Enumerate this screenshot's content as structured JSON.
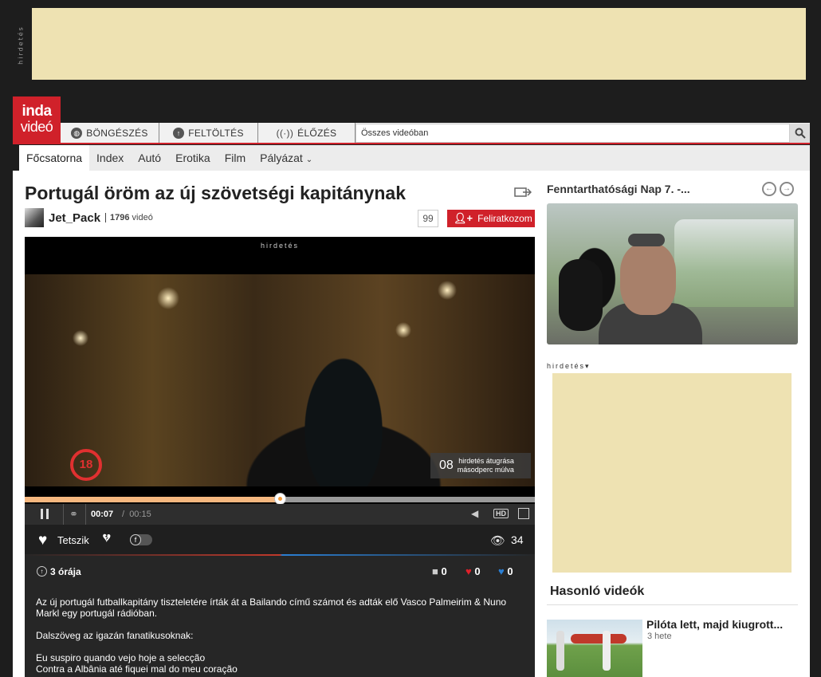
{
  "top_ad": {
    "label": "hirdetés"
  },
  "logo": {
    "line1": "inda",
    "line2": "videó"
  },
  "nav": {
    "browse": "BÖNGÉSZÉS",
    "upload": "FELTÖLTÉS",
    "live": "ÉLŐZÉS",
    "search_placeholder": "Összes videóban"
  },
  "subnav": {
    "items": [
      "Főcsatorna",
      "Index",
      "Autó",
      "Erotika",
      "Film",
      "Pályázat"
    ],
    "active_index": 0
  },
  "video": {
    "title": "Portugál öröm az új szövetségi kapitánynak",
    "uploader": "Jet_Pack",
    "uploader_video_count": "1796",
    "uploader_video_unit": "videó",
    "subscriber_count": "99",
    "subscribe_label": "Feliratkozom",
    "player_ad_label": "hirdetés",
    "age_rating": "18",
    "skip_seconds": "08",
    "skip_text_1": "hirdetés átugrása",
    "skip_text_2": "másodperc múlva",
    "current_time": "00:07",
    "time_separator": "/",
    "duration": "00:15",
    "progress": 0.5,
    "hd_label": "HD",
    "like_label": "Tetszik",
    "views": "34",
    "uploaded_ago": "3 órája",
    "comments": "0",
    "likes": "0",
    "dislikes": "0",
    "description": [
      "Az új portugál futballkapitány tiszteletére írták át a Bailando című számot és adták elő Vasco Palmeirim & Nuno Markl egy portugál rádióban.",
      "Dalszöveg az igazán fanatikusoknak:",
      "Eu suspiro quando vejo hoje a selecção",
      "Contra a Albânia até fiquei mal do meu coração"
    ]
  },
  "sidebar": {
    "featured_title": "Fenntarthatósági Nap 7. -...",
    "ad_label": "hirdetés",
    "similar_title": "Hasonló videók",
    "similar": [
      {
        "title": "Pilóta lett, majd kiugrott...",
        "age": "3 hete"
      }
    ]
  },
  "colors": {
    "brand": "#d0212a",
    "ad_bg": "#eee2b2",
    "dark": "#262626"
  }
}
